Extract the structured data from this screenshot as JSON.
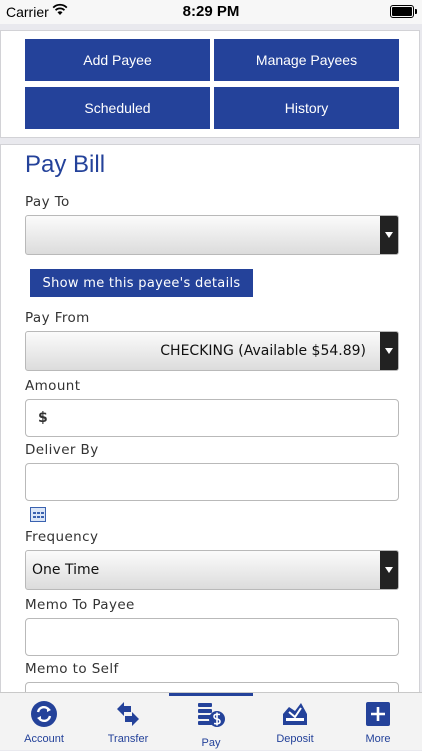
{
  "status": {
    "carrier": "Carrier",
    "time": "8:29 PM"
  },
  "nav": {
    "add_payee": "Add Payee",
    "manage_payees": "Manage Payees",
    "scheduled": "Scheduled",
    "history": "History"
  },
  "form": {
    "title": "Pay Bill",
    "pay_to_label": "Pay To",
    "pay_to_value": "",
    "details_button": "Show me this payee's details",
    "pay_from_label": "Pay From",
    "pay_from_value": "CHECKING (Available $54.89)",
    "amount_label": "Amount",
    "amount_prefix": "$",
    "deliver_by_label": "Deliver By",
    "frequency_label": "Frequency",
    "frequency_value": "One Time",
    "memo_payee_label": "Memo To Payee",
    "memo_self_label": "Memo to Self"
  },
  "tabs": [
    {
      "label": "Account",
      "icon": "account-icon"
    },
    {
      "label": "Transfer",
      "icon": "transfer-icon"
    },
    {
      "label": "Pay",
      "icon": "pay-icon",
      "active": true
    },
    {
      "label": "Deposit",
      "icon": "deposit-icon"
    },
    {
      "label": "More",
      "icon": "plus-icon"
    }
  ],
  "colors": {
    "brand": "#24429a",
    "background": "#e9e9ee"
  }
}
